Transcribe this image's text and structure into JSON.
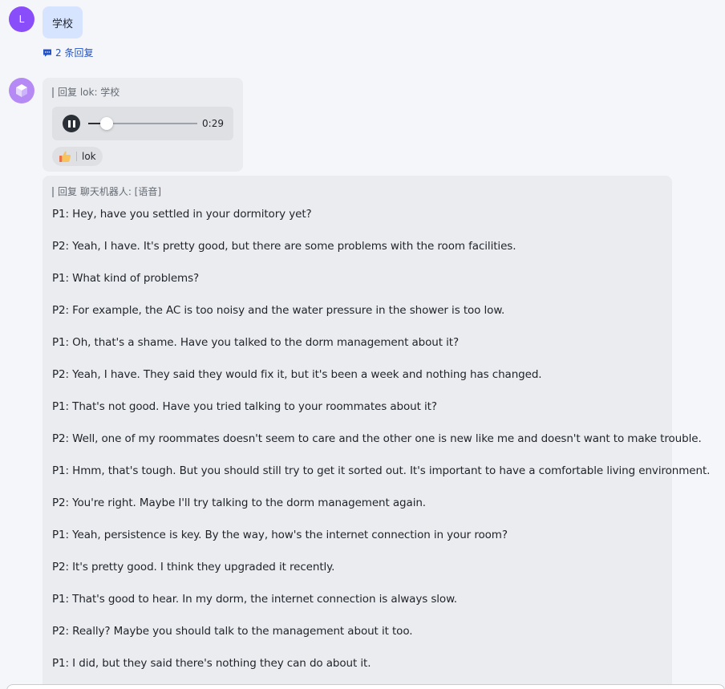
{
  "colors": {
    "background": "#f5f6fa",
    "user_bubble": "#d6e4ff",
    "bot_card": "#ebecef",
    "link": "#2453c6",
    "user_avatar": "#8a4dfa",
    "bot_avatar": "#b58af5"
  },
  "user_message": {
    "avatar_initial": "L",
    "text": "学校",
    "thread_icon": "comment-icon",
    "thread_link": "2 条回复"
  },
  "voice_reply": {
    "avatar_icon": "cube-icon",
    "quote": "回复 lok: 学校",
    "player": {
      "state_icon": "pause-icon",
      "progress": 0.17,
      "duration": "0:29"
    },
    "reaction": {
      "icon": "thumbs-up-icon",
      "user": "lok"
    }
  },
  "text_reply": {
    "quote": "回复 聊天机器人: [语音]",
    "lines": [
      "P1: Hey, have you settled in your dormitory yet?",
      "P2: Yeah, I have. It's pretty good, but there are some problems with the room facilities.",
      "P1: What kind of problems?",
      "P2: For example, the AC is too noisy and the water pressure in the shower is too low.",
      "P1: Oh, that's a shame. Have you talked to the dorm management about it?",
      "P2: Yeah, I have. They said they would fix it, but it's been a week and nothing has changed.",
      "P1: That's not good. Have you tried talking to your roommates about it?",
      "P2: Well, one of my roommates doesn't seem to care and the other one is new like me and doesn't want to make trouble.",
      "P1: Hmm, that's tough. But you should still try to get it sorted out. It's important to have a comfortable living environment.",
      "P2: You're right. Maybe I'll try talking to the dorm management again.",
      "P1: Yeah, persistence is key. By the way, how's the internet connection in your room?",
      "P2: It's pretty good. I think they upgraded it recently.",
      "P1: That's good to hear. In my dorm, the internet connection is always slow.",
      "P2: Really? Maybe you should talk to the management about it too.",
      "P1: I did, but they said there's nothing they can do about it."
    ]
  }
}
